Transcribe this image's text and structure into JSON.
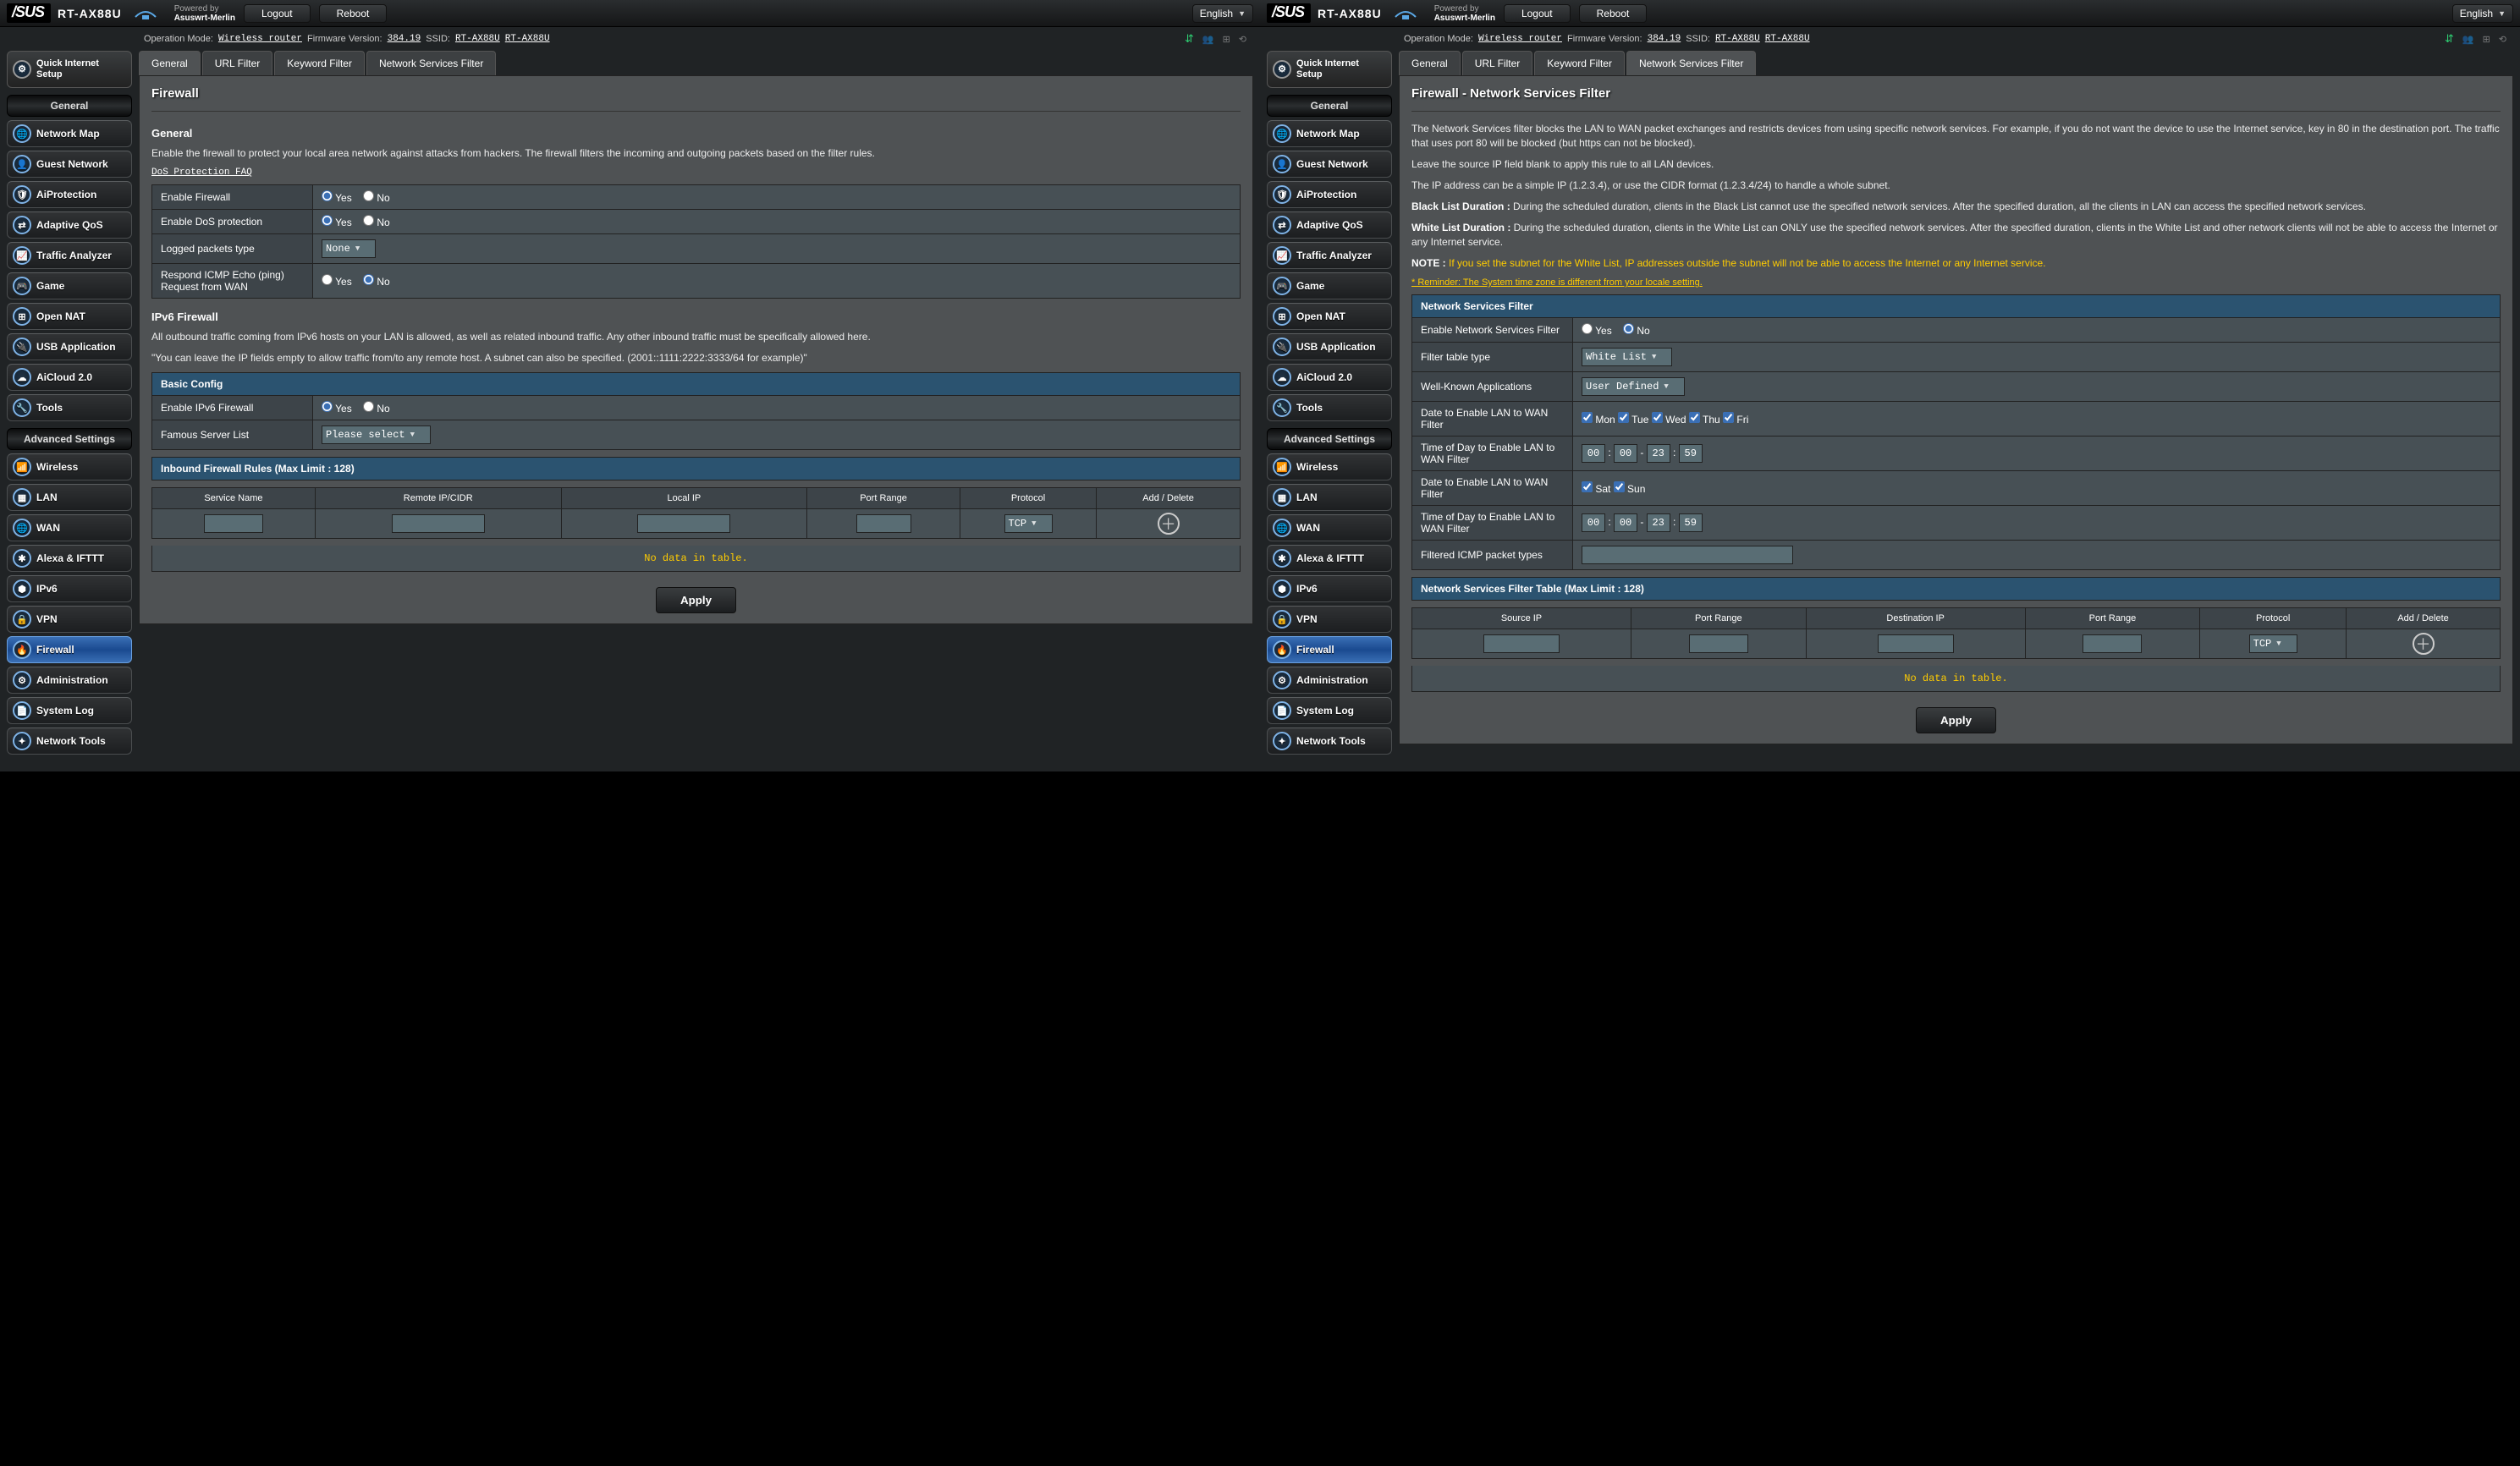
{
  "top": {
    "brand": "/SUS",
    "model": "RT-AX88U",
    "powered1": "Powered by",
    "powered2": "Asuswrt-Merlin",
    "logout": "Logout",
    "reboot": "Reboot",
    "language": "English"
  },
  "status": {
    "opmode_label": "Operation Mode:",
    "opmode": "Wireless router",
    "fw_label": "Firmware Version:",
    "fw": "384.19",
    "ssid_label": "SSID:",
    "ssid1": "RT-AX88U",
    "ssid2": "RT-AX88U"
  },
  "sidebar": {
    "qis": "Quick Internet Setup",
    "general_header": "General",
    "advanced_header": "Advanced Settings",
    "general": [
      "Network Map",
      "Guest Network",
      "AiProtection",
      "Adaptive QoS",
      "Traffic Analyzer",
      "Game",
      "Open NAT",
      "USB Application",
      "AiCloud 2.0",
      "Tools"
    ],
    "advanced": [
      "Wireless",
      "LAN",
      "WAN",
      "Alexa & IFTTT",
      "IPv6",
      "VPN",
      "Firewall",
      "Administration",
      "System Log",
      "Network Tools"
    ]
  },
  "tabs": [
    "General",
    "URL Filter",
    "Keyword Filter",
    "Network Services Filter"
  ],
  "left": {
    "title": "Firewall",
    "general_head": "General",
    "desc": "Enable the firewall to protect your local area network against attacks from hackers. The firewall filters the incoming and outgoing packets based on the filter rules.",
    "faq": "DoS Protection FAQ",
    "rows": {
      "enable_fw": "Enable Firewall",
      "enable_dos": "Enable DoS protection",
      "log_type": "Logged packets type",
      "log_value": "None",
      "icmp": "Respond ICMP Echo (ping) Request from WAN"
    },
    "yes": "Yes",
    "no": "No",
    "ipv6_head": "IPv6 Firewall",
    "ipv6_desc": "All outbound traffic coming from IPv6 hosts on your LAN is allowed, as well as related inbound traffic. Any other inbound traffic must be specifically allowed here.",
    "ipv6_hint": "\"You can leave the IP fields empty to allow traffic from/to any remote host. A subnet can also be specified. (2001::1111:2222:3333/64 for example)\"",
    "basic_head": "Basic Config",
    "enable_ipv6fw": "Enable IPv6 Firewall",
    "famous": "Famous Server List",
    "famous_value": "Please select",
    "inbound_head": "Inbound Firewall Rules (Max Limit : 128)",
    "cols": [
      "Service Name",
      "Remote IP/CIDR",
      "Local IP",
      "Port Range",
      "Protocol",
      "Add / Delete"
    ],
    "protocol_default": "TCP",
    "nodata": "No data in table.",
    "apply": "Apply"
  },
  "right": {
    "title": "Firewall - Network Services Filter",
    "para1": "The Network Services filter blocks the LAN to WAN packet exchanges and restricts devices from using specific network services. For example, if you do not want the device to use the Internet service, key in 80 in the destination port. The traffic that uses port 80 will be blocked (but https can not be blocked).",
    "para1b": "Leave the source IP field blank to apply this rule to all LAN devices.",
    "para2": "The IP address can be a simple IP (1.2.3.4), or use the CIDR format (1.2.3.4/24) to handle a whole subnet.",
    "bl_label": "Black List Duration :",
    "bl": "During the scheduled duration, clients in the Black List cannot use the specified network services. After the specified duration, all the clients in LAN can access the specified network services.",
    "wl_label": "White List Duration :",
    "wl": "During the scheduled duration, clients in the White List can ONLY use the specified network services. After the specified duration, clients in the White List and other network clients will not be able to access the Internet or any Internet service.",
    "note_label": "NOTE :",
    "note": "If you set the subnet for the White List, IP addresses outside the subnet will not be able to access the Internet or any Internet service.",
    "reminder": "* Reminder: The System time zone is different from your locale setting.",
    "table_head": "Network Services Filter",
    "rows": {
      "enable": "Enable Network Services Filter",
      "type": "Filter table type",
      "type_value": "White List",
      "apps": "Well-Known Applications",
      "apps_value": "User Defined",
      "date1": "Date to Enable LAN to WAN Filter",
      "time1": "Time of Day to Enable LAN to WAN Filter",
      "date2": "Date to Enable LAN to WAN Filter",
      "time2": "Time of Day to Enable LAN to WAN Filter",
      "icmp": "Filtered ICMP packet types"
    },
    "days1": [
      "Mon",
      "Tue",
      "Wed",
      "Thu",
      "Fri"
    ],
    "days2": [
      "Sat",
      "Sun"
    ],
    "time_a": [
      "00",
      "00",
      "23",
      "59"
    ],
    "time_b": [
      "00",
      "00",
      "23",
      "59"
    ],
    "yes": "Yes",
    "no": "No",
    "filter_head": "Network Services Filter Table (Max Limit : 128)",
    "cols": [
      "Source IP",
      "Port Range",
      "Destination IP",
      "Port Range",
      "Protocol",
      "Add / Delete"
    ],
    "protocol_default": "TCP",
    "nodata": "No data in table.",
    "apply": "Apply"
  }
}
